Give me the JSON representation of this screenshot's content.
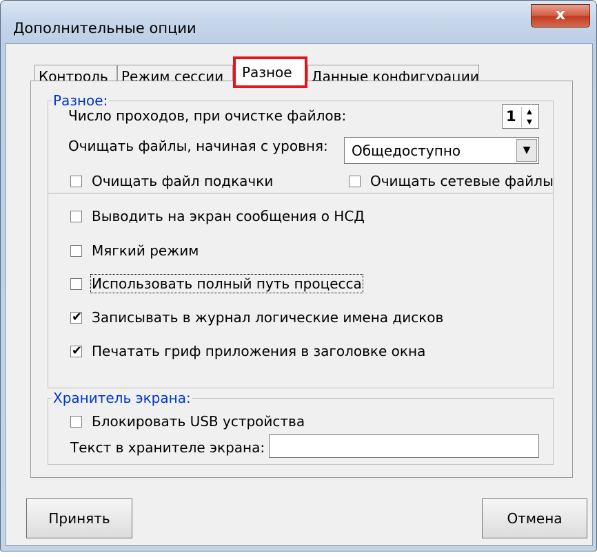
{
  "window": {
    "title": "Дополнительные опции",
    "close_glyph": "x"
  },
  "tabs": [
    {
      "label": "Контроль"
    },
    {
      "label": "Режим сессии"
    },
    {
      "label": "Разное",
      "active": true
    },
    {
      "label": "Данные конфигурации"
    }
  ],
  "misc": {
    "legend": "Разное:",
    "passes_label": "Число проходов, при очистке файлов:",
    "passes_value": "1",
    "level_label": "Очищать файлы, начиная с уровня:",
    "level_value": "Общедоступно",
    "clear_swap": {
      "label": "Очищать файл подкачки",
      "checked": false
    },
    "clear_network": {
      "label": "Очищать сетевые файлы",
      "checked": false
    }
  },
  "options": [
    {
      "label": "Выводить на экран сообщения о НСД",
      "checked": false
    },
    {
      "label": "Мягкий режим",
      "checked": false
    },
    {
      "label": "Использовать полный путь процесса",
      "checked": false
    },
    {
      "label": "Записывать в журнал логические имена дисков",
      "checked": true
    },
    {
      "label": "Печатать гриф приложения в заголовке окна",
      "checked": true
    }
  ],
  "screensaver": {
    "legend": "Хранитель экрана:",
    "block_usb": {
      "label": "Блокировать USB устройства",
      "checked": false
    },
    "text_label": "Текст в хранителе экрана:",
    "text_value": ""
  },
  "buttons": {
    "accept": "Принять",
    "cancel": "Отмена"
  },
  "icons": {
    "spin": "spin-arrows-icon",
    "dropdown": "chevron-down-icon",
    "check": "checkmark-icon"
  },
  "colors": {
    "active_tab_highlight": "#e8141c",
    "legend_text": "#0033cc"
  }
}
